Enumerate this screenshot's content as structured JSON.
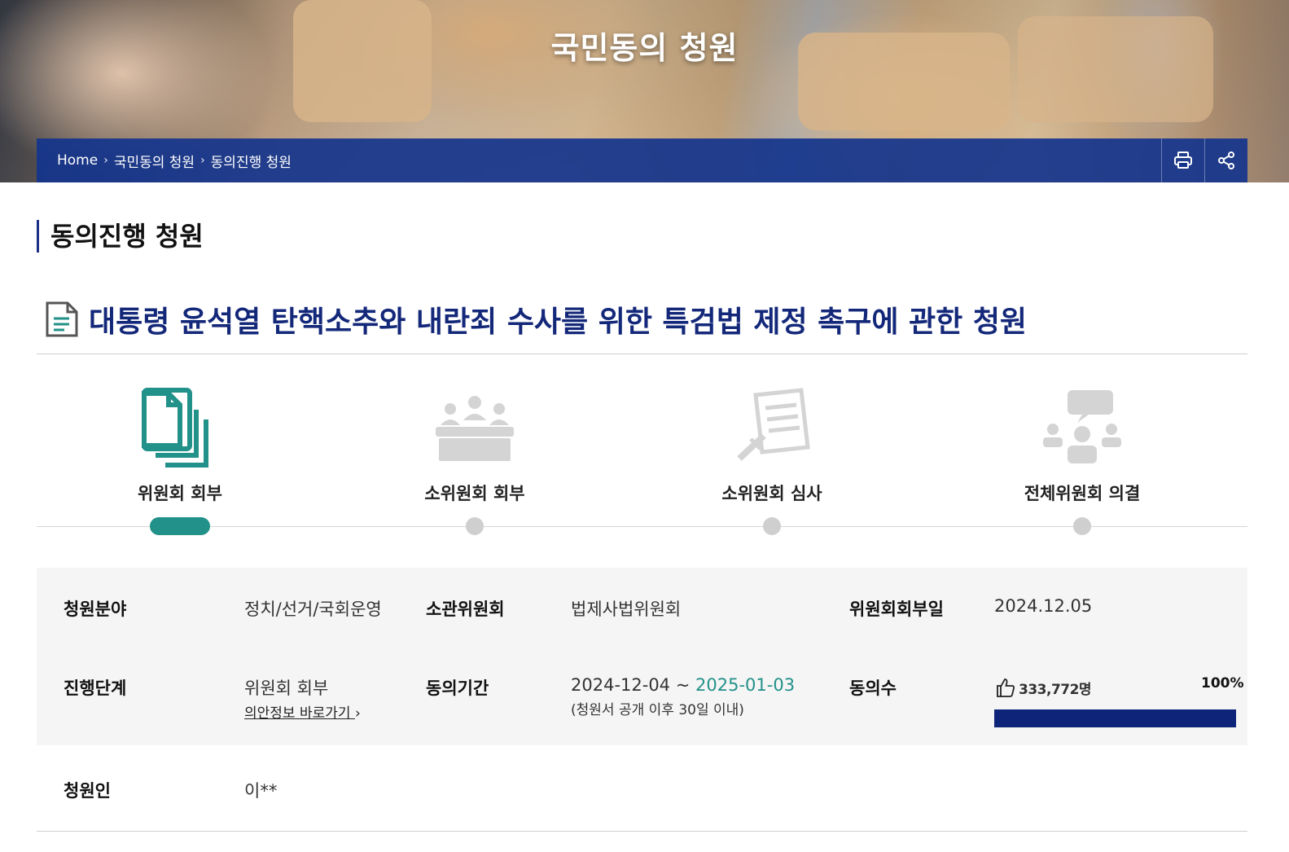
{
  "hero": {
    "title": "국민동의 청원"
  },
  "breadcrumb": {
    "items": [
      "Home",
      "국민동의 청원",
      "동의진행 청원"
    ]
  },
  "toolbar": {
    "print_icon": "print-icon",
    "share_icon": "share-icon"
  },
  "section": {
    "title": "동의진행 청원"
  },
  "petition": {
    "title": "대통령 윤석열 탄핵소추와 내란죄 수사를 위한 특검법 제정 촉구에 관한 청원"
  },
  "steps": [
    {
      "label": "위원회 회부",
      "icon": "documents-icon",
      "active": true
    },
    {
      "label": "소위원회 회부",
      "icon": "meeting-icon",
      "active": false
    },
    {
      "label": "소위원회 심사",
      "icon": "review-icon",
      "active": false
    },
    {
      "label": "전체위원회 의결",
      "icon": "discussion-icon",
      "active": false
    }
  ],
  "info": {
    "field_label": "청원분야",
    "field_value": "정치/선거/국회운영",
    "committee_label": "소관위원회",
    "committee_value": "법제사법위원회",
    "referral_date_label": "위원회회부일",
    "referral_date_value": "2024.12.05",
    "stage_label": "진행단계",
    "stage_value": "위원회 회부",
    "stage_link": "의안정보 바로가기",
    "period_label": "동의기간",
    "period_start": "2024-12-04 ~",
    "period_end": "2025-01-03",
    "period_note": "(청원서 공개 이후 30일 이내)",
    "agree_label": "동의수",
    "agree_count": "333,772명",
    "agree_percent_text": "100%",
    "agree_fraction": 1.0,
    "petitioner_label": "청원인",
    "petitioner_value": "이**"
  },
  "colors": {
    "navy": "#14287a",
    "teal": "#229189",
    "bar": "#0e2478"
  }
}
